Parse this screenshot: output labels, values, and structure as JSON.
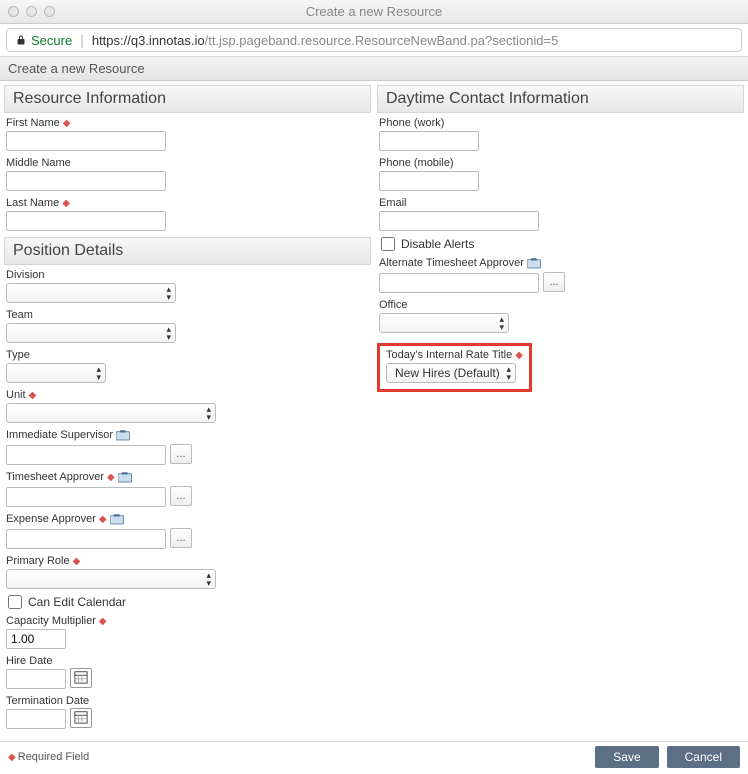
{
  "window": {
    "title": "Create a new Resource"
  },
  "browser": {
    "secure_label": "Secure",
    "url_host": "https://q3.innotas.io",
    "url_path": "/tt.jsp.pageband.resource.ResourceNewBand.pa?sectionid=5"
  },
  "page": {
    "header": "Create a new Resource"
  },
  "sections": {
    "resource_info": "Resource Information",
    "position_details": "Position Details",
    "daytime_contact": "Daytime Contact Information"
  },
  "left": {
    "first_name": {
      "label": "First Name",
      "value": ""
    },
    "middle_name": {
      "label": "Middle Name",
      "value": ""
    },
    "last_name": {
      "label": "Last Name",
      "value": ""
    },
    "division": {
      "label": "Division",
      "value": ""
    },
    "team": {
      "label": "Team",
      "value": ""
    },
    "type": {
      "label": "Type",
      "value": ""
    },
    "unit": {
      "label": "Unit",
      "value": ""
    },
    "immediate_supervisor": {
      "label": "Immediate Supervisor",
      "value": ""
    },
    "timesheet_approver": {
      "label": "Timesheet Approver",
      "value": ""
    },
    "expense_approver": {
      "label": "Expense Approver",
      "value": ""
    },
    "primary_role": {
      "label": "Primary Role",
      "value": ""
    },
    "can_edit_calendar": {
      "label": "Can Edit Calendar",
      "checked": false
    },
    "capacity_multiplier": {
      "label": "Capacity Multiplier",
      "value": "1.00"
    },
    "hire_date": {
      "label": "Hire Date",
      "value": ""
    },
    "termination_date": {
      "label": "Termination Date",
      "value": ""
    }
  },
  "right": {
    "phone_work": {
      "label": "Phone (work)",
      "value": ""
    },
    "phone_mobile": {
      "label": "Phone (mobile)",
      "value": ""
    },
    "email": {
      "label": "Email",
      "value": ""
    },
    "disable_alerts": {
      "label": "Disable Alerts",
      "checked": false
    },
    "alt_timesheet_approver": {
      "label": "Alternate Timesheet Approver",
      "value": ""
    },
    "office": {
      "label": "Office",
      "value": ""
    },
    "rate_title": {
      "label": "Today's Internal Rate Title",
      "value": "New Hires (Default)"
    }
  },
  "footer": {
    "required_field": "Required Field",
    "save": "Save",
    "cancel": "Cancel"
  },
  "misc": {
    "ellipsis": "..."
  }
}
